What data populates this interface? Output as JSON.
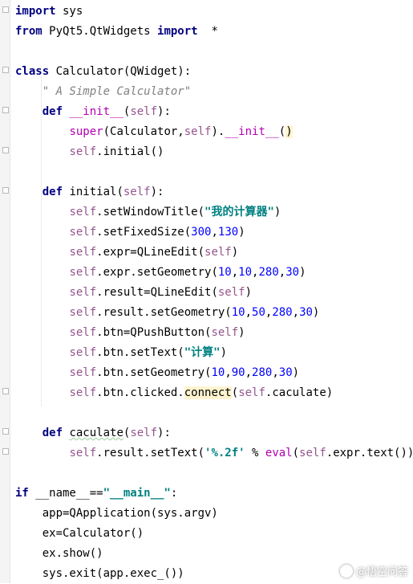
{
  "editor": {
    "lines": [
      {
        "indent": "",
        "tokens": [
          {
            "t": "import",
            "c": "kw"
          },
          {
            "t": " sys",
            "c": ""
          }
        ]
      },
      {
        "indent": "",
        "tokens": [
          {
            "t": "from",
            "c": "kw"
          },
          {
            "t": " PyQt5.QtWidgets ",
            "c": ""
          },
          {
            "t": "import",
            "c": "kw"
          },
          {
            "t": "  *",
            "c": ""
          }
        ]
      },
      {
        "indent": "",
        "tokens": []
      },
      {
        "indent": "",
        "tokens": [
          {
            "t": "class",
            "c": "kw"
          },
          {
            "t": " Calculator(QWidget):",
            "c": ""
          }
        ]
      },
      {
        "indent": "    ",
        "tokens": [
          {
            "t": "\" A Simple Calculator\"",
            "c": "doc"
          }
        ]
      },
      {
        "indent": "    ",
        "tokens": [
          {
            "t": "def",
            "c": "kw"
          },
          {
            "t": " ",
            "c": ""
          },
          {
            "t": "__init__",
            "c": "mag"
          },
          {
            "t": "(",
            "c": ""
          },
          {
            "t": "self",
            "c": "self"
          },
          {
            "t": "):",
            "c": ""
          }
        ]
      },
      {
        "indent": "        ",
        "tokens": [
          {
            "t": "super",
            "c": "fn"
          },
          {
            "t": "(Calculator,",
            "c": ""
          },
          {
            "t": "self",
            "c": "self"
          },
          {
            "t": ").",
            "c": ""
          },
          {
            "t": "__init__",
            "c": "mag"
          },
          {
            "t": "(",
            "c": ""
          },
          {
            "t": ")",
            "c": "hl"
          }
        ]
      },
      {
        "indent": "        ",
        "tokens": [
          {
            "t": "self",
            "c": "self"
          },
          {
            "t": ".initial()",
            "c": ""
          }
        ]
      },
      {
        "indent": "",
        "tokens": []
      },
      {
        "indent": "    ",
        "tokens": [
          {
            "t": "def",
            "c": "kw"
          },
          {
            "t": " initial(",
            "c": ""
          },
          {
            "t": "self",
            "c": "self"
          },
          {
            "t": "):",
            "c": ""
          }
        ]
      },
      {
        "indent": "        ",
        "tokens": [
          {
            "t": "self",
            "c": "self"
          },
          {
            "t": ".setWindowTitle(",
            "c": ""
          },
          {
            "t": "\"我的计算器\"",
            "c": "str"
          },
          {
            "t": ")",
            "c": ""
          }
        ]
      },
      {
        "indent": "        ",
        "tokens": [
          {
            "t": "self",
            "c": "self"
          },
          {
            "t": ".setFixedSize(",
            "c": ""
          },
          {
            "t": "300",
            "c": "num"
          },
          {
            "t": ",",
            "c": ""
          },
          {
            "t": "130",
            "c": "num"
          },
          {
            "t": ")",
            "c": ""
          }
        ]
      },
      {
        "indent": "        ",
        "tokens": [
          {
            "t": "self",
            "c": "self"
          },
          {
            "t": ".expr=QLineEdit(",
            "c": ""
          },
          {
            "t": "self",
            "c": "self"
          },
          {
            "t": ")",
            "c": ""
          }
        ]
      },
      {
        "indent": "        ",
        "tokens": [
          {
            "t": "self",
            "c": "self"
          },
          {
            "t": ".expr.setGeometry(",
            "c": ""
          },
          {
            "t": "10",
            "c": "num"
          },
          {
            "t": ",",
            "c": ""
          },
          {
            "t": "10",
            "c": "num"
          },
          {
            "t": ",",
            "c": ""
          },
          {
            "t": "280",
            "c": "num"
          },
          {
            "t": ",",
            "c": ""
          },
          {
            "t": "30",
            "c": "num"
          },
          {
            "t": ")",
            "c": ""
          }
        ]
      },
      {
        "indent": "        ",
        "tokens": [
          {
            "t": "self",
            "c": "self"
          },
          {
            "t": ".result=QLineEdit(",
            "c": ""
          },
          {
            "t": "self",
            "c": "self"
          },
          {
            "t": ")",
            "c": ""
          }
        ]
      },
      {
        "indent": "        ",
        "tokens": [
          {
            "t": "self",
            "c": "self"
          },
          {
            "t": ".result.setGeometry(",
            "c": ""
          },
          {
            "t": "10",
            "c": "num"
          },
          {
            "t": ",",
            "c": ""
          },
          {
            "t": "50",
            "c": "num"
          },
          {
            "t": ",",
            "c": ""
          },
          {
            "t": "280",
            "c": "num"
          },
          {
            "t": ",",
            "c": ""
          },
          {
            "t": "30",
            "c": "num"
          },
          {
            "t": ")",
            "c": ""
          }
        ]
      },
      {
        "indent": "        ",
        "tokens": [
          {
            "t": "self",
            "c": "self"
          },
          {
            "t": ".btn=QPushButton(",
            "c": ""
          },
          {
            "t": "self",
            "c": "self"
          },
          {
            "t": ")",
            "c": ""
          }
        ]
      },
      {
        "indent": "        ",
        "tokens": [
          {
            "t": "self",
            "c": "self"
          },
          {
            "t": ".btn.setText(",
            "c": ""
          },
          {
            "t": "\"计算\"",
            "c": "str"
          },
          {
            "t": ")",
            "c": ""
          }
        ]
      },
      {
        "indent": "        ",
        "tokens": [
          {
            "t": "self",
            "c": "self"
          },
          {
            "t": ".btn.setGeometry(",
            "c": ""
          },
          {
            "t": "10",
            "c": "num"
          },
          {
            "t": ",",
            "c": ""
          },
          {
            "t": "90",
            "c": "num"
          },
          {
            "t": ",",
            "c": ""
          },
          {
            "t": "280",
            "c": "num"
          },
          {
            "t": ",",
            "c": ""
          },
          {
            "t": "30",
            "c": "num"
          },
          {
            "t": ")",
            "c": ""
          }
        ]
      },
      {
        "indent": "        ",
        "tokens": [
          {
            "t": "self",
            "c": "self"
          },
          {
            "t": ".btn.clicked.",
            "c": ""
          },
          {
            "t": "connect",
            "c": "hl"
          },
          {
            "t": "(",
            "c": ""
          },
          {
            "t": "self",
            "c": "self"
          },
          {
            "t": ".caculate)",
            "c": ""
          }
        ]
      },
      {
        "indent": "",
        "tokens": []
      },
      {
        "indent": "    ",
        "tokens": [
          {
            "t": "def",
            "c": "kw"
          },
          {
            "t": " ",
            "c": ""
          },
          {
            "t": "caculate",
            "c": "squig"
          },
          {
            "t": "(",
            "c": ""
          },
          {
            "t": "self",
            "c": "self"
          },
          {
            "t": "):",
            "c": ""
          }
        ]
      },
      {
        "indent": "        ",
        "tokens": [
          {
            "t": "self",
            "c": "self"
          },
          {
            "t": ".result.setText(",
            "c": ""
          },
          {
            "t": "'%.2f'",
            "c": "str"
          },
          {
            "t": " % ",
            "c": ""
          },
          {
            "t": "eval",
            "c": "fn"
          },
          {
            "t": "(",
            "c": ""
          },
          {
            "t": "self",
            "c": "self"
          },
          {
            "t": ".expr.text()))",
            "c": ""
          }
        ]
      },
      {
        "indent": "",
        "tokens": []
      },
      {
        "indent": "",
        "tokens": [
          {
            "t": "if",
            "c": "kw"
          },
          {
            "t": " __name__==",
            "c": ""
          },
          {
            "t": "\"__main__\"",
            "c": "str"
          },
          {
            "t": ":",
            "c": ""
          }
        ]
      },
      {
        "indent": "    ",
        "tokens": [
          {
            "t": "app=QApplication(sys.argv)",
            "c": ""
          }
        ]
      },
      {
        "indent": "    ",
        "tokens": [
          {
            "t": "ex=Calculator()",
            "c": ""
          }
        ]
      },
      {
        "indent": "    ",
        "tokens": [
          {
            "t": "ex.show()",
            "c": ""
          }
        ]
      },
      {
        "indent": "    ",
        "tokens": [
          {
            "t": "sys.exit(app.exec_())",
            "c": ""
          }
        ]
      }
    ]
  },
  "watermark": {
    "icon": "chat-bubble-icon",
    "text": "@悟空问答"
  }
}
